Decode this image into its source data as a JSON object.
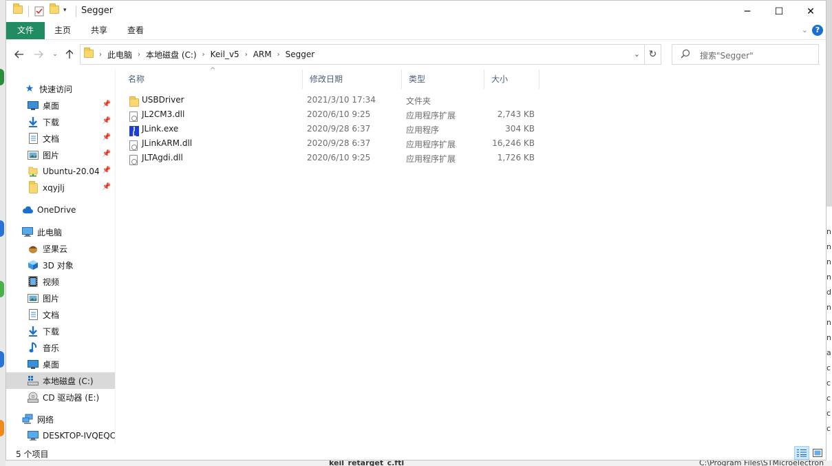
{
  "window": {
    "title": "Segger",
    "controls": {
      "minimize": "─",
      "maximize": "☐",
      "close": "✕"
    }
  },
  "ribbon": {
    "tabs": [
      "文件",
      "主页",
      "共享",
      "查看"
    ],
    "help": "?"
  },
  "address": {
    "crumbs": [
      "此电脑",
      "本地磁盘 (C:)",
      "Keil_v5",
      "ARM",
      "Segger"
    ]
  },
  "search": {
    "placeholder": "搜索\"Segger\""
  },
  "nav": {
    "quick_access": "快速访问",
    "pinned": [
      "桌面",
      "下载",
      "文档",
      "图片",
      "Ubuntu-20.04",
      "xqyjlj"
    ],
    "onedrive": "OneDrive",
    "this_pc": "此电脑",
    "pc_items": [
      "坚果云",
      "3D 对象",
      "视频",
      "图片",
      "文档",
      "下载",
      "音乐",
      "桌面",
      "本地磁盘 (C:)",
      "CD 驱动器 (E:)"
    ],
    "network": "网络",
    "network_items": [
      "DESKTOP-IVQEQC"
    ]
  },
  "columns": {
    "name": "名称",
    "date": "修改日期",
    "type": "类型",
    "size": "大小"
  },
  "files": [
    {
      "name": "USBDriver",
      "date": "2021/3/10 17:34",
      "type": "文件夹",
      "size": "",
      "icon": "folder-icon"
    },
    {
      "name": "JL2CM3.dll",
      "date": "2020/6/10 9:25",
      "type": "应用程序扩展",
      "size": "2,743 KB",
      "icon": "dll-icon"
    },
    {
      "name": "JLink.exe",
      "date": "2020/9/28 6:37",
      "type": "应用程序",
      "size": "304 KB",
      "icon": "jlink-exe-icon"
    },
    {
      "name": "JLinkARM.dll",
      "date": "2020/9/28 6:37",
      "type": "应用程序扩展",
      "size": "16,246 KB",
      "icon": "dll-icon"
    },
    {
      "name": "JLTAgdi.dll",
      "date": "2020/6/10 9:25",
      "type": "应用程序扩展",
      "size": "1,726 KB",
      "icon": "dll-icon"
    }
  ],
  "status": {
    "count": "5 个项目"
  },
  "background": {
    "bottom_left": "keil_retarget_c.ftl",
    "bottom_right": "C:\\Program Files\\STMicroelectron"
  },
  "colors": {
    "file_tab": "#218b62",
    "selected_nav": "#d9d9d9",
    "header_text": "#4c607a",
    "help_icon": "#1b6fd1"
  }
}
